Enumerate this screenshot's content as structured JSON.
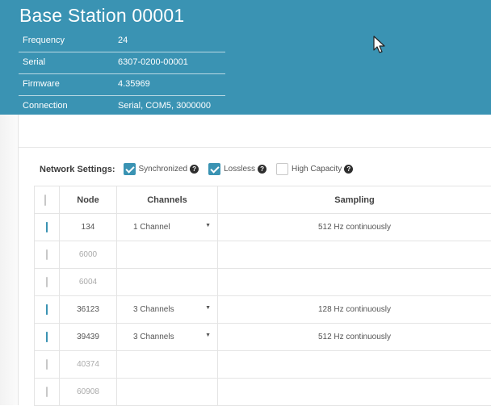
{
  "header": {
    "title": "Base Station 00001",
    "info": [
      {
        "label": "Frequency",
        "value": "24"
      },
      {
        "label": "Serial",
        "value": "6307-0200-00001"
      },
      {
        "label": "Firmware",
        "value": "4.35969"
      },
      {
        "label": "Connection",
        "value": "Serial, COM5, 3000000"
      }
    ]
  },
  "network_settings": {
    "label": "Network Settings:",
    "options": [
      {
        "label": "Synchronized",
        "checked": true
      },
      {
        "label": "Lossless",
        "checked": true
      },
      {
        "label": "High Capacity",
        "checked": false
      }
    ]
  },
  "table": {
    "headers": {
      "node": "Node",
      "channels": "Channels",
      "sampling": "Sampling"
    },
    "rows": [
      {
        "checked": true,
        "node": "134",
        "channels": "1 Channel",
        "sampling": "512 Hz continuously"
      },
      {
        "checked": false,
        "node": "6000",
        "channels": "",
        "sampling": ""
      },
      {
        "checked": false,
        "node": "6004",
        "channels": "",
        "sampling": ""
      },
      {
        "checked": true,
        "node": "36123",
        "channels": "3 Channels",
        "sampling": "128 Hz continuously"
      },
      {
        "checked": true,
        "node": "39439",
        "channels": "3 Channels",
        "sampling": "512 Hz continuously"
      },
      {
        "checked": false,
        "node": "40374",
        "channels": "",
        "sampling": ""
      },
      {
        "checked": false,
        "node": "60908",
        "channels": "",
        "sampling": ""
      }
    ]
  },
  "colors": {
    "accent": "#3a93b3",
    "header_text": "#ffffff"
  }
}
